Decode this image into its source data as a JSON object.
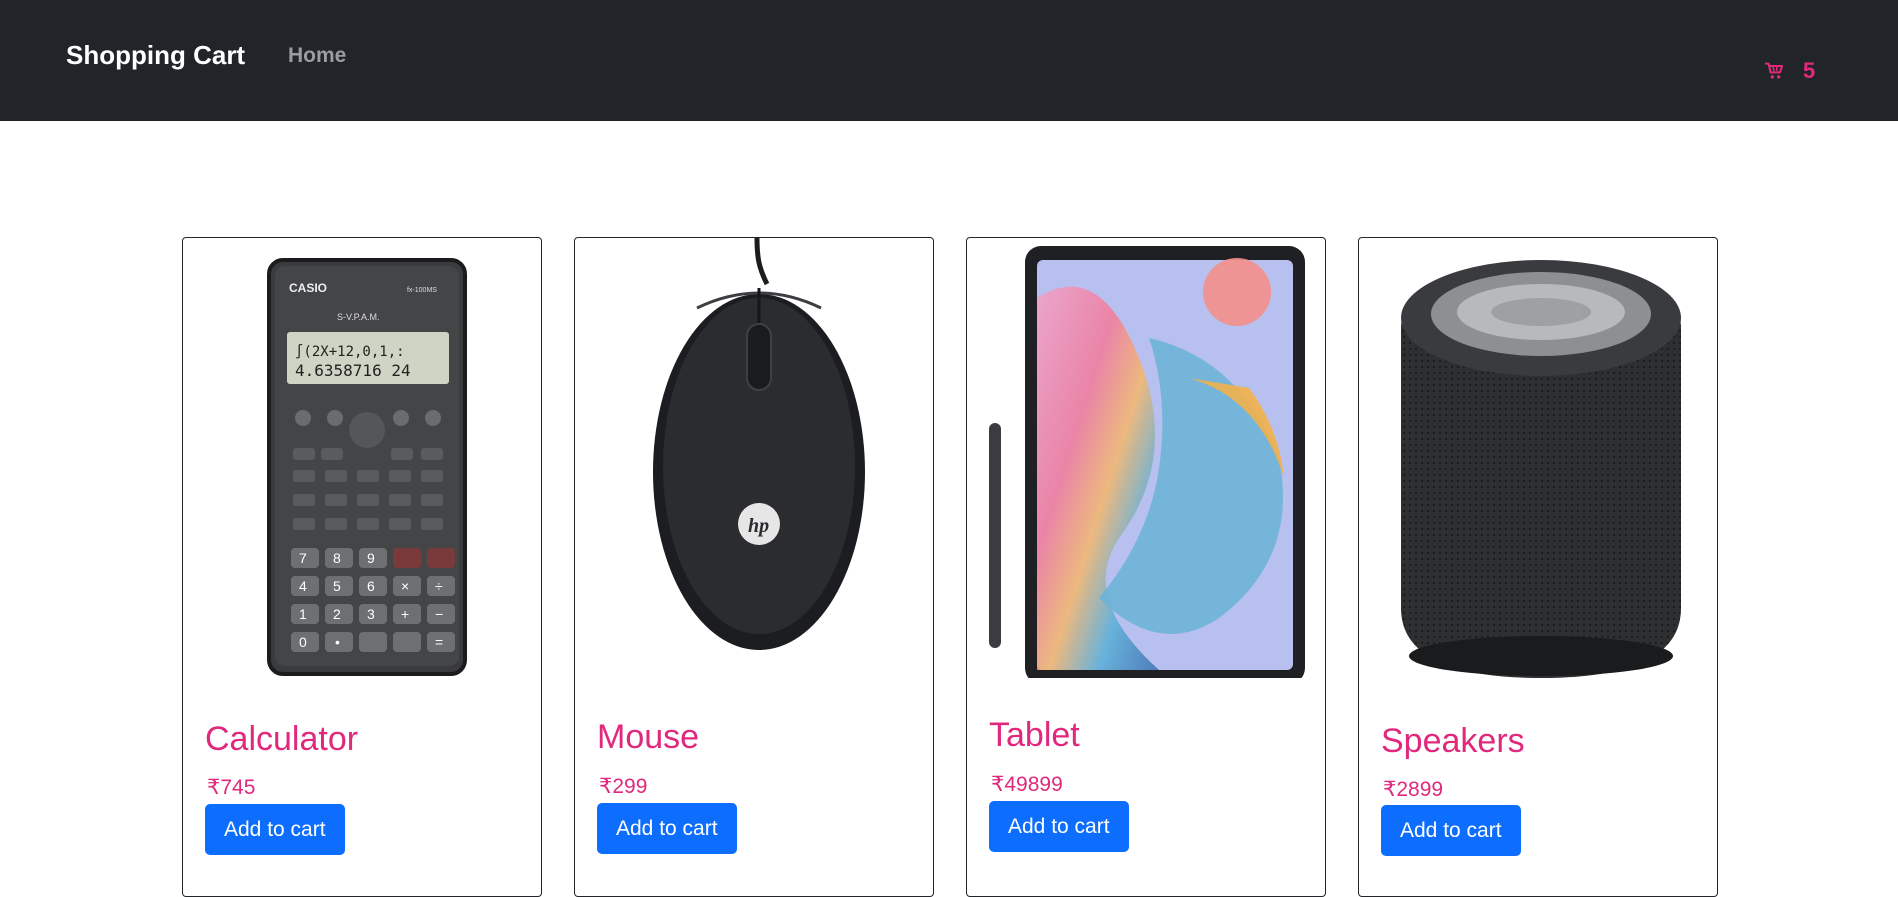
{
  "navbar": {
    "brand": "Shopping Cart",
    "home": "Home",
    "cart_icon": "cart-icon",
    "cart_count": "5",
    "accent": "#e5297a"
  },
  "products": [
    {
      "title": "Calculator",
      "price": "₹745",
      "button": "Add to cart",
      "image": "calculator-image"
    },
    {
      "title": "Mouse",
      "price": "₹299",
      "button": "Add to cart",
      "image": "mouse-image"
    },
    {
      "title": "Tablet",
      "price": "₹49899",
      "button": "Add to cart",
      "image": "tablet-image"
    },
    {
      "title": "Speakers",
      "price": "₹2899",
      "button": "Add to cart",
      "image": "speaker-image"
    }
  ],
  "colors": {
    "navbar_bg": "#212529",
    "title_pink": "#e0287c",
    "button_blue": "#0d6efd"
  }
}
